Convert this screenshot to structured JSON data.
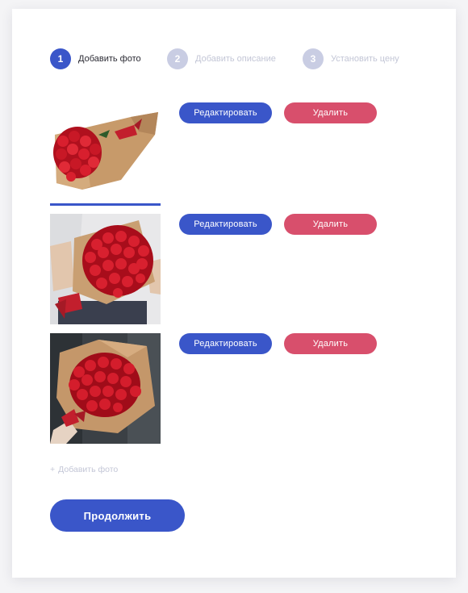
{
  "stepper": {
    "steps": [
      {
        "number": "1",
        "label": "Добавить фото",
        "state": "active"
      },
      {
        "number": "2",
        "label": "Добавить описание",
        "state": "inactive"
      },
      {
        "number": "3",
        "label": "Установить цену",
        "state": "inactive"
      }
    ]
  },
  "photos": {
    "edit_label": "Редактировать",
    "delete_label": "Удалить",
    "items": [
      {
        "description": "bouquet-on-white"
      },
      {
        "description": "bouquet-held"
      },
      {
        "description": "bouquet-dark"
      }
    ]
  },
  "add_photo": {
    "icon": "+",
    "label": "Добавить фото"
  },
  "continue_label": "Продолжить",
  "colors": {
    "primary": "#3a56c9",
    "danger": "#d84f6c",
    "inactive_step": "#c9cde3",
    "inactive_text": "#c3c6d6"
  }
}
